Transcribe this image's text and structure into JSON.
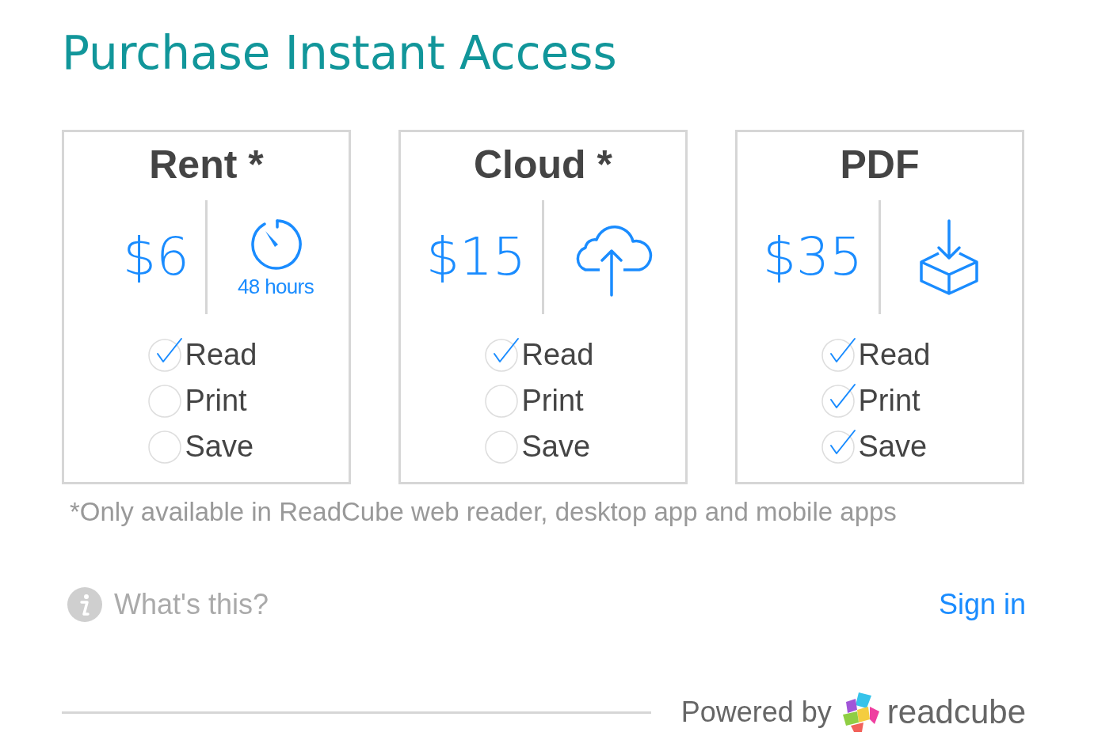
{
  "title": "Purchase Instant Access",
  "plans": [
    {
      "name": "Rent *",
      "price": "$6",
      "kind": "timer",
      "caption": "48 hours",
      "features": [
        {
          "label": "Read",
          "checked": true
        },
        {
          "label": "Print",
          "checked": false
        },
        {
          "label": "Save",
          "checked": false
        }
      ]
    },
    {
      "name": "Cloud *",
      "price": "$15",
      "kind": "cloud",
      "features": [
        {
          "label": "Read",
          "checked": true
        },
        {
          "label": "Print",
          "checked": false
        },
        {
          "label": "Save",
          "checked": false
        }
      ]
    },
    {
      "name": "PDF",
      "price": "$35",
      "kind": "download",
      "features": [
        {
          "label": "Read",
          "checked": true
        },
        {
          "label": "Print",
          "checked": true
        },
        {
          "label": "Save",
          "checked": true
        }
      ]
    }
  ],
  "footnote": "*Only available in ReadCube web reader, desktop app and mobile apps",
  "help_link": "What's this?",
  "sign_in": "Sign in",
  "powered_by": "Powered by",
  "brand": "readcube"
}
